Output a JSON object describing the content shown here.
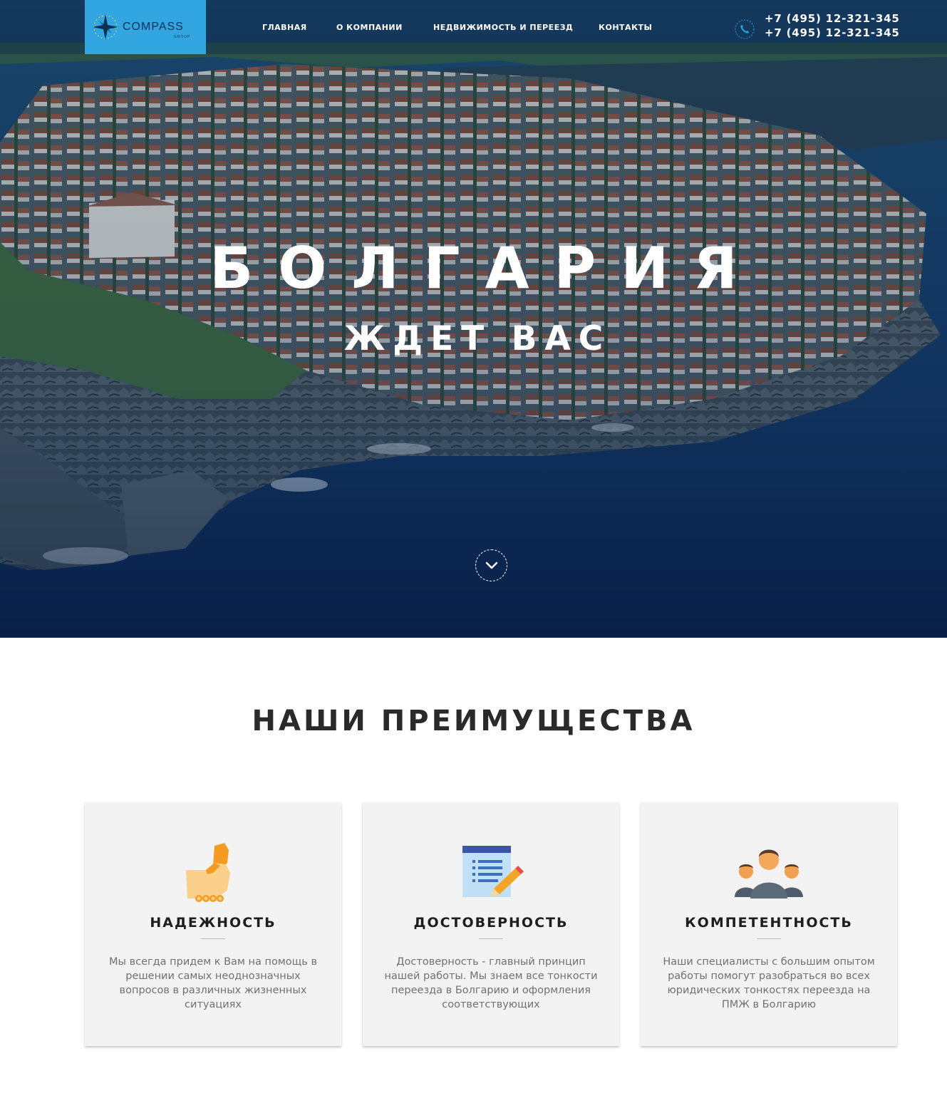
{
  "brand": {
    "name": "COMPASS",
    "sub": "GROUP",
    "color": "#32a6e0"
  },
  "nav": {
    "items": [
      {
        "label": "ГЛАВНАЯ"
      },
      {
        "label": "О КОМПАНИИ"
      },
      {
        "label": "НЕДВИЖИМОСТЬ И ПЕРЕЕЗД"
      },
      {
        "label": "КОНТАКТЫ"
      }
    ]
  },
  "contacts": {
    "icon": "phone-icon",
    "phones": [
      "+7 (495) 12-321-345",
      "+7 (495) 12-321-345"
    ]
  },
  "hero": {
    "title": "БОЛГАРИЯ",
    "subtitle": "ЖДЕТ ВАС",
    "scroll_icon": "chevron-down-icon"
  },
  "advantages": {
    "title": "НАШИ ПРЕИМУЩЕСТВА",
    "items": [
      {
        "icon": "handshake-icon",
        "title": "НАДЕЖНОСТЬ",
        "text": "Мы всегда придем к Вам на помощь в решении самых неоднозначных вопросов в различных жизненных ситуациях"
      },
      {
        "icon": "notepad-pencil-icon",
        "title": "ДОСТОВЕРНОСТЬ",
        "text": "Достоверность - главный принцип нашей работы. Мы знаем все тонкости переезда в Болгарию и оформления соответствующих"
      },
      {
        "icon": "team-icon",
        "title": "КОМПЕТЕНТНОСТЬ",
        "text": "Наши специалисты с большим опытом работы помогут разобраться во всех юридических тонкостях переезда на ПМЖ в Болгарию"
      }
    ]
  }
}
